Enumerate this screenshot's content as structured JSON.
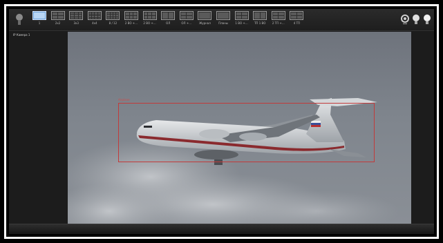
{
  "toolbar": {
    "layouts": [
      {
        "label": "1",
        "icon": "layout-1-icon",
        "active": true
      },
      {
        "label": "2x2",
        "icon": "layout-2x2-icon"
      },
      {
        "label": "3x3",
        "icon": "layout-3x3-icon"
      },
      {
        "label": "4x4",
        "icon": "layout-4x4-icon"
      },
      {
        "label": "8 / 12",
        "icon": "layout-8-12-icon"
      },
      {
        "label": "2 ВО +…",
        "icon": "layout-2-icon"
      },
      {
        "label": "2 ВО +…",
        "icon": "layout-2b-icon"
      },
      {
        "label": "ОЛ",
        "icon": "layout-ol-icon"
      },
      {
        "label": "ОЛ +…",
        "icon": "layout-ol-plus-icon"
      },
      {
        "label": "Журнал",
        "icon": "journal-icon"
      },
      {
        "label": "Планы",
        "icon": "plans-icon"
      },
      {
        "label": "1 ВО +…",
        "icon": "layout-1vo-icon"
      },
      {
        "label": "ТП 1 ВО",
        "icon": "layout-tp-icon"
      },
      {
        "label": "2 ТП +…",
        "icon": "layout-2tp-icon"
      },
      {
        "label": "4 ТП",
        "icon": "layout-4tp-icon"
      }
    ],
    "right_icons": [
      "settings-icon",
      "info-icon",
      "light-icon"
    ]
  },
  "camera": {
    "label": "IP Камера 1"
  },
  "detection": {
    "label": "Airplane"
  },
  "colors": {
    "detection_box": "#c23a3a",
    "active_layout": "#6aa0d8"
  }
}
